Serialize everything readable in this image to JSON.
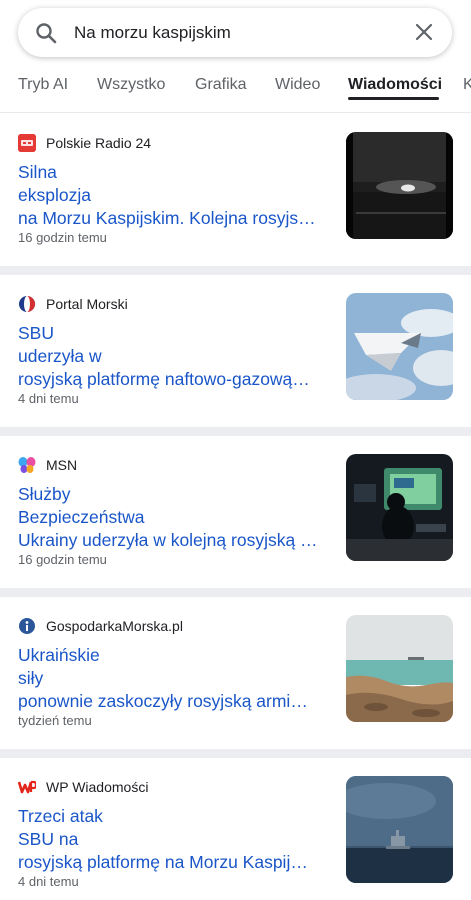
{
  "search": {
    "query": "Na morzu kaspijskim"
  },
  "tabs": [
    {
      "label": "Tryb AI"
    },
    {
      "label": "Wszystko"
    },
    {
      "label": "Grafika"
    },
    {
      "label": "Wideo"
    },
    {
      "label": "Wiadomości",
      "active": true
    },
    {
      "label": "K"
    }
  ],
  "articles": [
    {
      "source": "Polskie Radio 24",
      "headline_lines": [
        "Silna",
        "eksplozja",
        "na Morzu Kaspijskim. Kolejna rosyjs…"
      ],
      "time": "16 godzin temu",
      "favicon_color": "#e53935",
      "thumb_icon": "night-explosion-image"
    },
    {
      "source": "Portal Morski",
      "headline_lines": [
        "SBU",
        "uderzyła w",
        "rosyjską platformę naftowo-gazową…"
      ],
      "time": "4 dni temu",
      "favicon_color": "#1e3a8a",
      "thumb_icon": "drone-sky-image"
    },
    {
      "source": "MSN",
      "headline_lines": [
        "Służby",
        "Bezpieczeństwa",
        "Ukrainy uderzyła w kolejną rosyjską …"
      ],
      "time": "16 godzin temu",
      "favicon_color": "#8e44ad",
      "thumb_icon": "operator-screens-image"
    },
    {
      "source": "GospodarkaMorska.pl",
      "headline_lines": [
        "Ukraińskie",
        "siły",
        "ponownie zaskoczyły rosyjską armi…"
      ],
      "time": "tydzień temu",
      "favicon_color": "#2b579a",
      "thumb_icon": "rocky-coast-image"
    },
    {
      "source": "WP Wiadomości",
      "headline_lines": [
        "Trzeci atak",
        "SBU na",
        "rosyjską platformę na Morzu Kaspij…"
      ],
      "time": "4 dni temu",
      "favicon_color": "#e2261c",
      "thumb_icon": "sea-platform-image"
    }
  ]
}
